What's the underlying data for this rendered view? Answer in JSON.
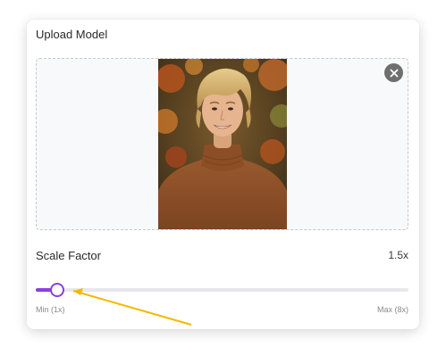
{
  "upload": {
    "title": "Upload Model",
    "image_subject": "portrait of smiling man with wavy blond hair in brown turtleneck sweater, autumn foliage background",
    "close_icon": "close-icon"
  },
  "scale": {
    "label": "Scale Factor",
    "value_text": "1.5x",
    "min_label": "Min (1x)",
    "max_label": "Max (8x)",
    "min": 1,
    "max": 8,
    "value": 1.5
  },
  "colors": {
    "accent": "#8b3fe0",
    "annotation_arrow": "#f5b800"
  }
}
